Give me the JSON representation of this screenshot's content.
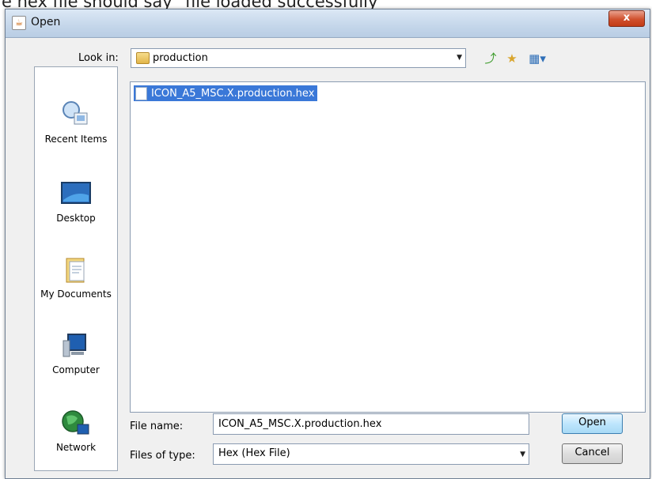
{
  "caption": "e hex file should say \"file loaded successfully\"",
  "window": {
    "title": "Open",
    "close_glyph": "x"
  },
  "lookin": {
    "label": "Look in:",
    "label_accel": "i",
    "folder": "production"
  },
  "places": [
    {
      "label": "Recent Items",
      "icon": "recent-items-icon"
    },
    {
      "label": "Desktop",
      "icon": "desktop-icon"
    },
    {
      "label": "My Documents",
      "icon": "my-documents-icon"
    },
    {
      "label": "Computer",
      "icon": "computer-icon"
    },
    {
      "label": "Network",
      "icon": "network-icon"
    }
  ],
  "files": [
    {
      "name": "ICON_A5_MSC.X.production.hex",
      "selected": true
    }
  ],
  "form": {
    "filename_label": "File name:",
    "filename_value": "ICON_A5_MSC.X.production.hex",
    "filetype_label": "Files of type:",
    "filetype_value": "Hex (Hex File)"
  },
  "buttons": {
    "open": "Open",
    "cancel": "Cancel"
  },
  "colors": {
    "selection": "#3a78d8",
    "dialog_bg": "#f0f0f0",
    "close_red": "#c23c16"
  }
}
